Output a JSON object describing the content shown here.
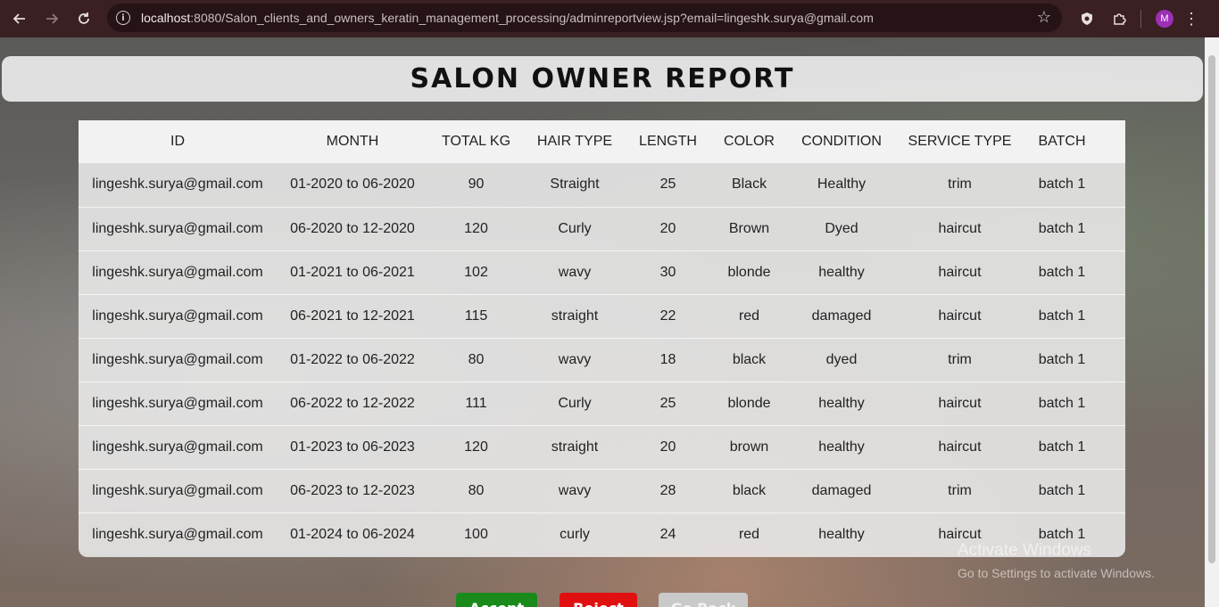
{
  "browser": {
    "url_host": "localhost",
    "url_rest": ":8080/Salon_clients_and_owners_keratin_management_processing/adminreportview.jsp?email=lingeshk.surya@gmail.com",
    "avatar_letter": "M",
    "icons": [
      "back-arrow-icon",
      "forward-arrow-icon",
      "reload-icon",
      "info-icon",
      "star-icon",
      "shield-icon",
      "puzzle-icon",
      "menu-icon"
    ]
  },
  "header": {
    "title": "SALON OWNER REPORT"
  },
  "table": {
    "columns": [
      "ID",
      "MONTH",
      "TOTAL KG",
      "HAIR TYPE",
      "LENGTH",
      "COLOR",
      "CONDITION",
      "SERVICE TYPE",
      "BATCH"
    ],
    "rows": [
      [
        "lingeshk.surya@gmail.com",
        "01-2020 to 06-2020",
        "90",
        "Straight",
        "25",
        "Black",
        "Healthy",
        "trim",
        "batch 1"
      ],
      [
        "lingeshk.surya@gmail.com",
        "06-2020 to 12-2020",
        "120",
        "Curly",
        "20",
        "Brown",
        "Dyed",
        "haircut",
        "batch 1"
      ],
      [
        "lingeshk.surya@gmail.com",
        "01-2021 to 06-2021",
        "102",
        "wavy",
        "30",
        "blonde",
        "healthy",
        "haircut",
        "batch 1"
      ],
      [
        "lingeshk.surya@gmail.com",
        "06-2021 to 12-2021",
        "115",
        "straight",
        "22",
        "red",
        "damaged",
        "haircut",
        "batch 1"
      ],
      [
        "lingeshk.surya@gmail.com",
        "01-2022 to 06-2022",
        "80",
        "wavy",
        "18",
        "black",
        "dyed",
        "trim",
        "batch 1"
      ],
      [
        "lingeshk.surya@gmail.com",
        "06-2022 to 12-2022",
        "111",
        "Curly",
        "25",
        "blonde",
        "healthy",
        "haircut",
        "batch 1"
      ],
      [
        "lingeshk.surya@gmail.com",
        "01-2023 to 06-2023",
        "120",
        "straight",
        "20",
        "brown",
        "healthy",
        "haircut",
        "batch 1"
      ],
      [
        "lingeshk.surya@gmail.com",
        "06-2023 to 12-2023",
        "80",
        "wavy",
        "28",
        "black",
        "damaged",
        "trim",
        "batch 1"
      ],
      [
        "lingeshk.surya@gmail.com",
        "01-2024 to 06-2024",
        "100",
        "curly",
        "24",
        "red",
        "healthy",
        "haircut",
        "batch 1"
      ]
    ]
  },
  "actions": {
    "accept": "Accept",
    "reject": "Reject",
    "back": "Go Back"
  },
  "watermark": {
    "title": "Activate Windows",
    "subtitle": "Go to Settings to activate Windows."
  },
  "colors": {
    "accept": "#1a8a1a",
    "reject": "#e01010",
    "back": "#c9c9c9",
    "chrome": "#3a1f23"
  }
}
